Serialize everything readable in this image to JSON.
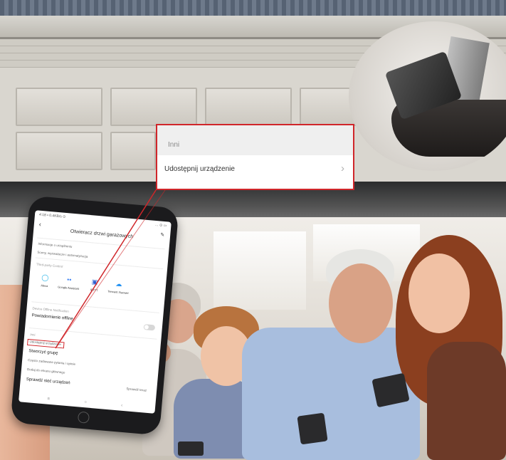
{
  "callout": {
    "section_label": "Inni",
    "share_item": "Udostępnij urządzenie",
    "chevron_icon": "chevron-right-icon"
  },
  "phone": {
    "status_left": "4:18 • 0.4KB/s ⊙",
    "status_right": "… ⊙ ▭",
    "title": "Otwieracz drzwi garażowych",
    "info_row": "Informacje o urządzeniu",
    "scene_row": "Sceny, wyzwalacze i automatyzacja",
    "third_party_label": "Third-party Control",
    "assistants": [
      {
        "label": "Alexa",
        "icon": "alexa-icon",
        "glyph": "◯",
        "color": "#1fb0e6"
      },
      {
        "label": "Google Assistant",
        "icon": "google-assistant-icon",
        "glyph": "••",
        "color": "#4285f4"
      },
      {
        "label": "IFTTT",
        "icon": "ifttt-icon",
        "glyph": "▣",
        "color": "#2c5fd1"
      },
      {
        "label": "Tencent Xiaowei",
        "icon": "tencent-xiaowei-icon",
        "glyph": "☁",
        "color": "#1f8ff2"
      }
    ],
    "offline_label": "Device Offline Notification",
    "offline_row": "Powiadomienie offline",
    "others_label": "Inni",
    "share_row": "Udostępnij urządzenie",
    "group_row": "Stworzyć grupę",
    "faq_row": "Często zadawane pytania i opinie",
    "home_screen_row": "Dodaj do ekranu głównego",
    "network_row": "Sprawdź sieć urządzeń",
    "network_action": "Sprawdź teraz",
    "nav": [
      "≡",
      "○",
      "‹"
    ]
  },
  "colors": {
    "accent": "#d0262a",
    "callout_band": "#efefef"
  }
}
